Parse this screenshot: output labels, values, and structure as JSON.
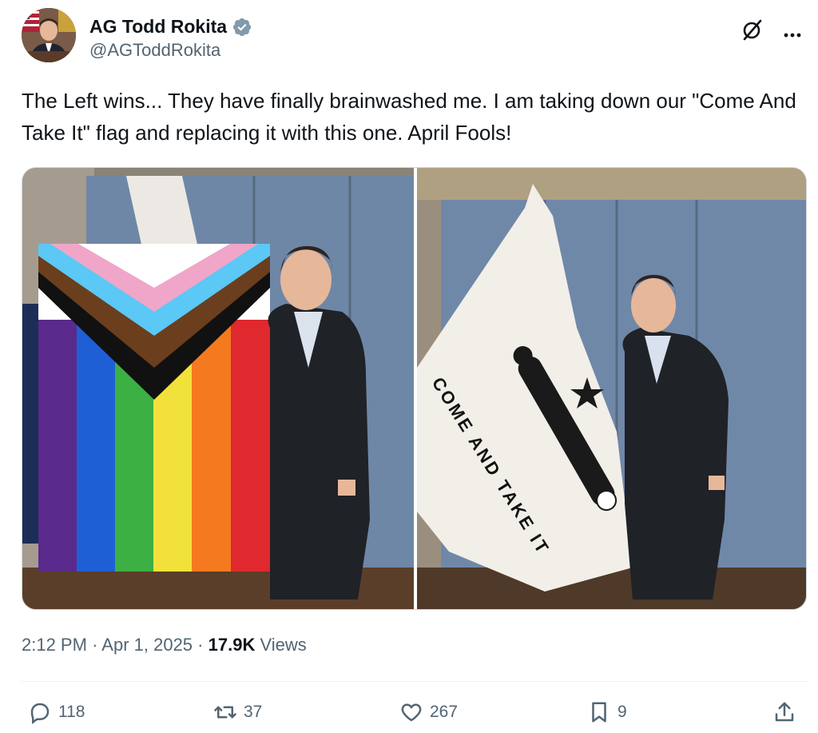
{
  "author": {
    "display_name": "AG Todd Rokita",
    "handle": "@AGToddRokita",
    "verified": true,
    "verified_badge_color": "#1d9bf0"
  },
  "tweet": {
    "text": "The Left wins... They have finally brainwashed me. I am taking down our \"Come And Take It\" flag and replacing it with this one. April Fools!"
  },
  "media": {
    "left_photo": {
      "flag_colors": [
        "#ffffff",
        "#f0a6c8",
        "#5bc8f5",
        "#6b3e1e",
        "#111111",
        "#5a2a8c",
        "#1f5fd6",
        "#3cb043",
        "#f2e13a",
        "#f57a1f",
        "#e0282f"
      ]
    },
    "right_photo": {
      "flag_text": "COME AND TAKE IT"
    }
  },
  "meta": {
    "time": "2:12 PM",
    "separator": "·",
    "date": "Apr 1, 2025",
    "views_count": "17.9K",
    "views_label": "Views"
  },
  "actions": {
    "reply_count": "118",
    "repost_count": "37",
    "like_count": "267",
    "bookmark_count": "9"
  },
  "icons": [
    "verified-badge-icon",
    "grok-icon",
    "more-icon",
    "reply-icon",
    "repost-icon",
    "like-icon",
    "bookmark-icon",
    "share-icon"
  ]
}
